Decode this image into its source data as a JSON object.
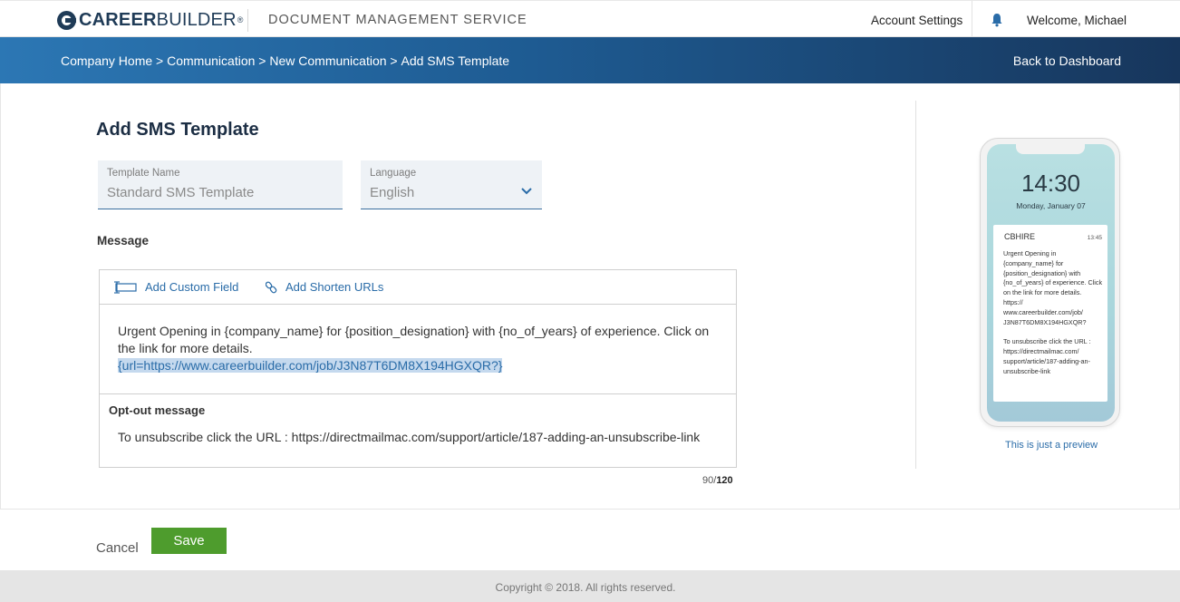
{
  "header": {
    "logo_bold": "CAREER",
    "logo_thin": "BUILDER",
    "logo_reg": "®",
    "app_title": "DOCUMENT MANAGEMENT SERVICE",
    "account_settings": "Account Settings",
    "welcome": "Welcome, Michael"
  },
  "breadcrumb": {
    "items": [
      "Company Home",
      "Communication",
      "New Communication",
      "Add SMS Template"
    ],
    "separator": " > ",
    "back_label": "Back to Dashboard"
  },
  "form": {
    "title": "Add SMS Template",
    "template_name": {
      "label": "Template Name",
      "value": "Standard SMS Template"
    },
    "language": {
      "label": "Language",
      "value": "English"
    },
    "message_label": "Message",
    "toolbar": {
      "add_custom_field": "Add Custom Field",
      "add_shorten_urls": "Add Shorten URLs"
    },
    "message_text": "Urgent Opening in {company_name} for {position_designation} with {no_of_years} of experience. Click on the link for more details.",
    "message_url": "{url=https://www.careerbuilder.com/job/J3N87T6DM8X194HGXQR?}",
    "optout_label": "Opt-out message",
    "optout_text": "To unsubscribe click the URL : https://directmailmac.com/support/article/187-adding-an-unsubscribe-link",
    "counter_current": "90",
    "counter_sep": "/",
    "counter_max": "120"
  },
  "preview": {
    "time": "14:30",
    "date": "Monday, January 07",
    "sender": "CBHIRE",
    "notif_time": "13:45",
    "body": "Urgent Opening in {company_name} for {position_designation} with {no_of_years} of experience. Click on the link for more details.",
    "url": "https:// www.careerbuilder.com/job/ J3N87T6DM8X194HGXQR?",
    "unsubscribe": "To unsubscribe click the URL : https://directmailmac.com/ support/article/187-adding-an-unsubscribe-link",
    "note": "This is just a preview"
  },
  "actions": {
    "cancel": "Cancel",
    "save": "Save"
  },
  "footer": {
    "copyright": "Copyright © 2018. All rights reserved."
  },
  "colors": {
    "accent_blue": "#2a6ca8",
    "save_green": "#4e9c2d",
    "banner_start": "#2c77b4",
    "banner_end": "#17365c"
  }
}
